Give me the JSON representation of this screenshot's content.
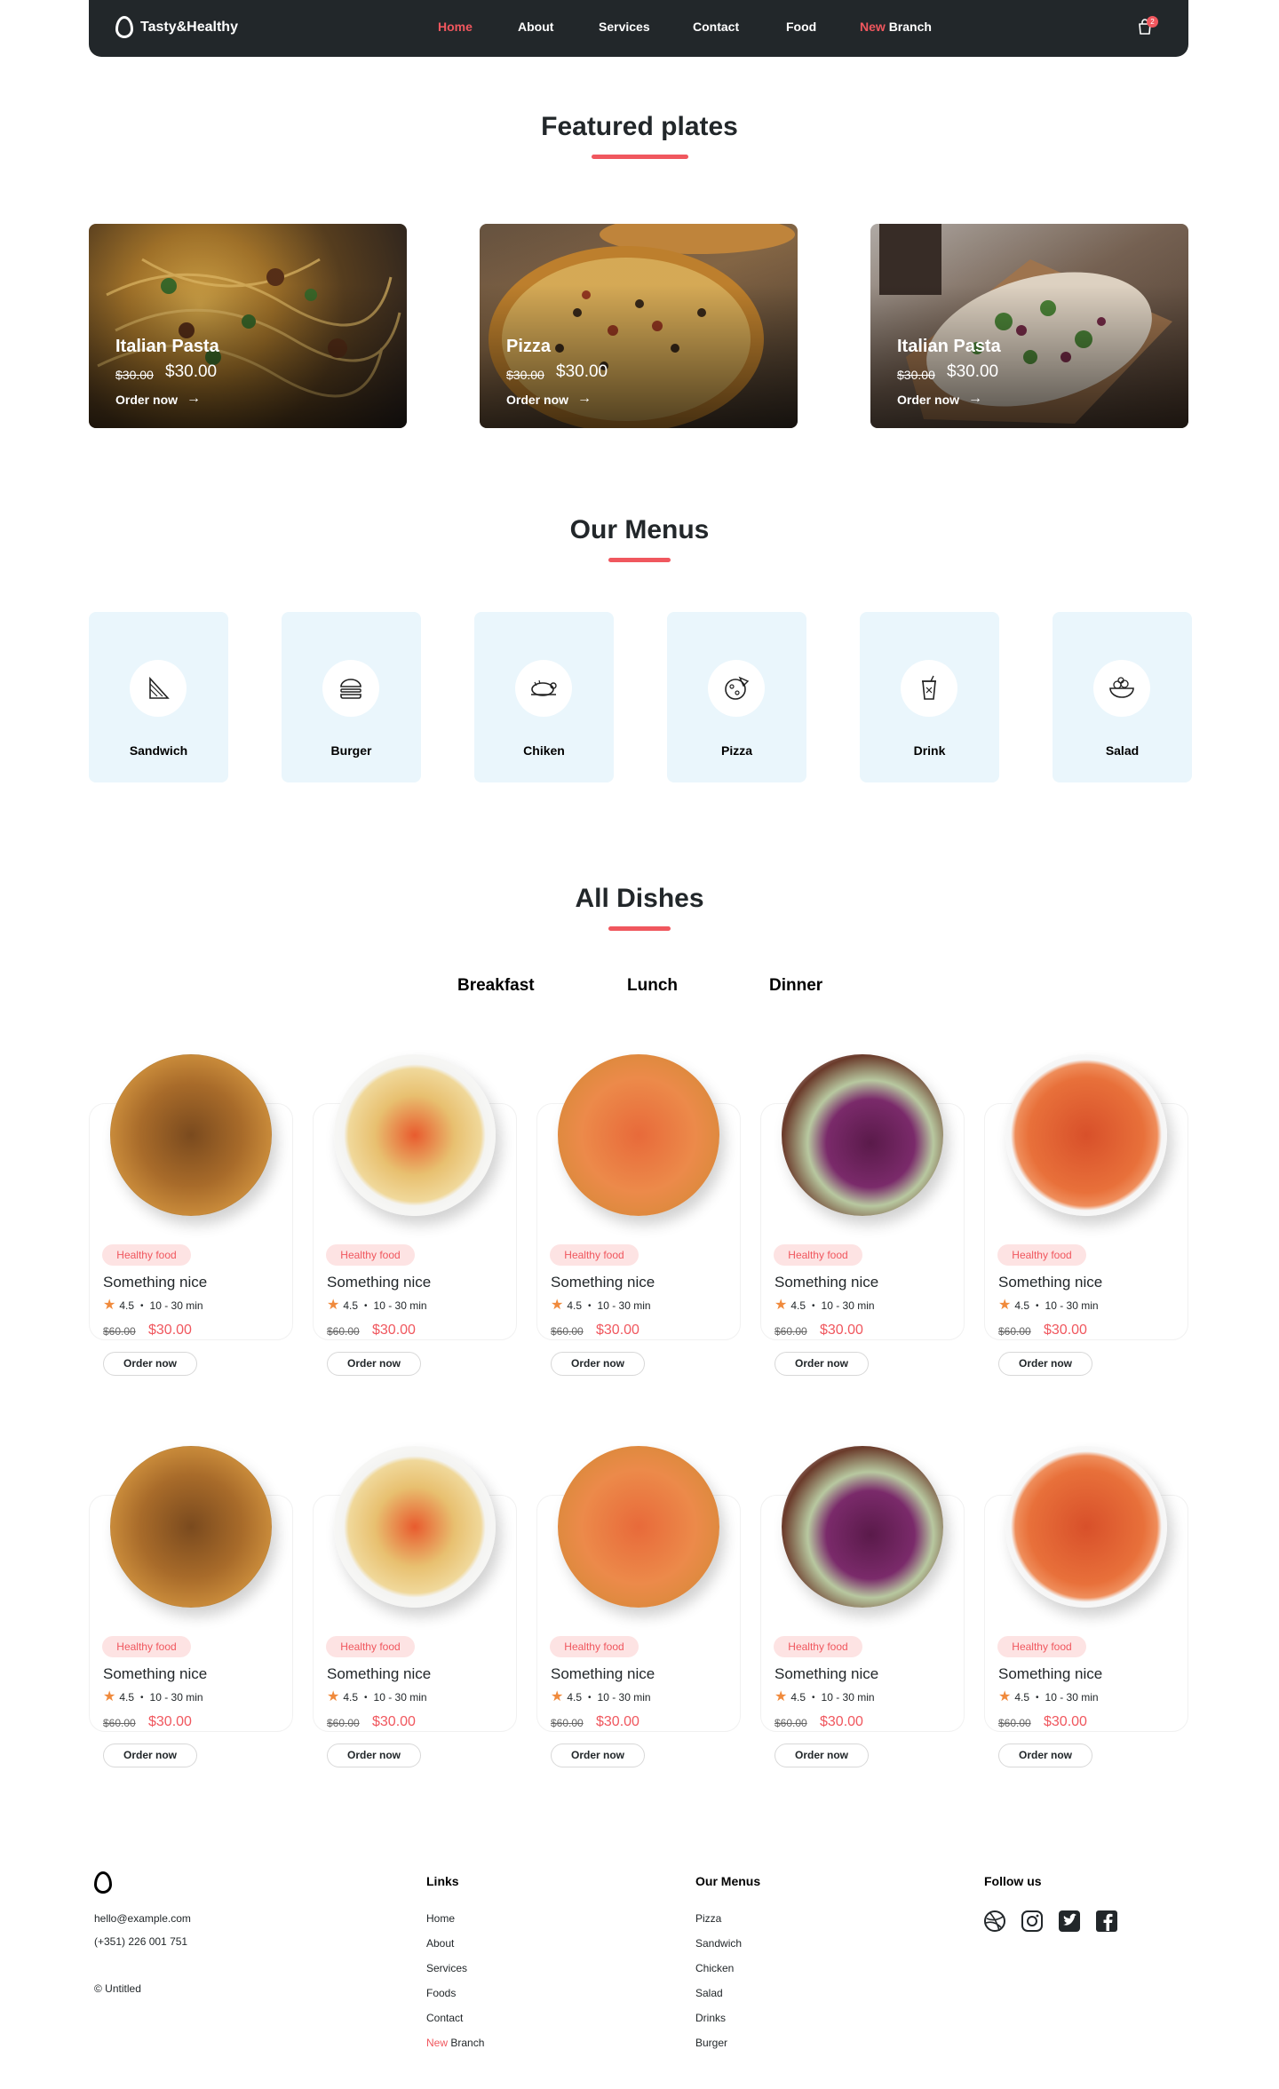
{
  "nav": {
    "brand": "Tasty&Healthy",
    "links": [
      {
        "label": "Home",
        "active": true
      },
      {
        "label": "About"
      },
      {
        "label": "Services"
      },
      {
        "label": "Contact"
      },
      {
        "label": "Food"
      }
    ],
    "branch_prefix": "New",
    "branch_label": "Branch",
    "cart_count": "2"
  },
  "featured": {
    "title": "Featured plates",
    "items": [
      {
        "title": "Italian Pasta",
        "old_price": "$30.00",
        "price": "$30.00",
        "cta": "Order now"
      },
      {
        "title": "Pizza",
        "old_price": "$30.00",
        "price": "$30.00",
        "cta": "Order now"
      },
      {
        "title": "Italian Pasta",
        "old_price": "$30.00",
        "price": "$30.00",
        "cta": "Order now"
      }
    ]
  },
  "menus": {
    "title": "Our Menus",
    "items": [
      {
        "label": "Sandwich",
        "icon": "sandwich-icon"
      },
      {
        "label": "Burger",
        "icon": "burger-icon"
      },
      {
        "label": "Chiken",
        "icon": "chicken-icon"
      },
      {
        "label": "Pizza",
        "icon": "pizza-icon"
      },
      {
        "label": "Drink",
        "icon": "drink-icon"
      },
      {
        "label": "Salad",
        "icon": "salad-icon"
      }
    ]
  },
  "dishes": {
    "title": "All Dishes",
    "tabs": [
      {
        "label": "Breakfast",
        "active": true
      },
      {
        "label": "Lunch"
      },
      {
        "label": "Dinner"
      }
    ],
    "card": {
      "tag": "Healthy food",
      "name": "Something nice",
      "rating": "4.5",
      "time": "10 - 30 min",
      "old_price": "$60.00",
      "price": "$30.00",
      "cta": "Order now"
    }
  },
  "footer": {
    "email": "hello@example.com",
    "phone": "(+351) 226 001 751",
    "copyright": "© Untitled",
    "links_title": "Links",
    "links": [
      "Home",
      "About",
      "Services",
      "Foods",
      "Contact"
    ],
    "links_branch_prefix": "New",
    "links_branch_label": "Branch",
    "menus_title": "Our Menus",
    "menus": [
      "Pizza",
      "Sandwich",
      "Chicken",
      "Salad",
      "Drinks",
      "Burger"
    ],
    "follow_title": "Follow us",
    "social_icons": [
      "dribbble-icon",
      "instagram-icon",
      "twitter-icon",
      "facebook-icon"
    ]
  },
  "colors": {
    "accent": "#f0575e",
    "nav_bg": "#22272a",
    "menu_tile": "#eaf6fc",
    "tag_bg": "#fde3e3",
    "star": "#f08a3c"
  }
}
